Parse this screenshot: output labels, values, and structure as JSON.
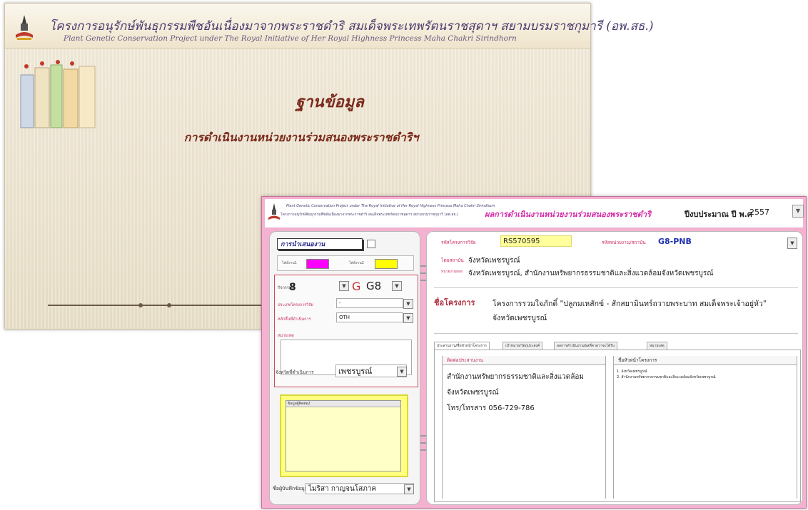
{
  "background_window": {
    "title_th": "โครงการอนุรักษ์พันธุกรรมพืชอันเนื่องมาจากพระราชดำริ สมเด็จพระเทพรัตนราชสุดาฯ สยามบรมราชกุมารี (อพ.สธ.)",
    "title_en": "Plant Genetic Conservation Project under The Royal Initiative of Her Royal Highness Princess Maha Chakri Sirindhorn",
    "main_title": "ฐานข้อมูล",
    "sub_title": "การดำเนินงานหน่วยงานร่วมสนองพระราชดำริฯ"
  },
  "form_window": {
    "header": {
      "project_en": "Plant Genetic Conservation Project under The Royal Initiative of Her Royal Highness Princess Maha Chakri Sirindhorn",
      "project_th": "โครงการอนุรักษ์พันธุกรรมพืชอันเนื่องมาจากพระราชดำริ สมเด็จพระเทพรัตนราชสุดาฯ สยามบรมราชกุมารี (อพ.สธ.)",
      "title": "ผลการดำเนินงานหน่วยงานร่วมสนองพระราชดำริ",
      "year_label": "ปีงบประมาณ ปี พ.ศ",
      "year_value": "2557"
    },
    "left": {
      "tag": "การนำเสนองาน",
      "status1_label": "ไฟล์งาน1",
      "status1_color": "#ff00ff",
      "status2_label": "ไฟล์งาน2",
      "status2_color": "#ffff00",
      "activity_label": "กิจกรรมที่",
      "activity_value": "8",
      "group_prefix": "G",
      "group_value": "G8",
      "research_type_label": "ประเภทโครงการวิจัย",
      "research_type_value": "-",
      "operation_label": "หลักสิ้นที่ดำเนินการ",
      "operation_value": "OTH",
      "note_label": "หมายเหตุ",
      "province_label": "จังหวัดที่ดำเนินการ",
      "province_value": "เพชรบูรณ์",
      "attachments_head": "ข้อมูลผู้ติดต่อ2",
      "recorder_label": "ชื่อผู้บันทึกข้อมูล",
      "recorder_value": "ไมริสา กาญจนโสภาค"
    },
    "right": {
      "research_code_label": "รหัสโครงการวิจัย",
      "research_code_value": "RS570595",
      "unit_code_label": "รหัสหน่วยงาน/สถาบัน",
      "unit_code_value": "G8-PNB",
      "institution_label": "โดยสถาบัน",
      "institution_value": "จังหวัดเพชรบูรณ์",
      "sub_unit_label": "หน่วยงานย่อย",
      "sub_unit_value": "จังหวัดเพชรบูรณ์, สำนักงานทรัพยากรธรรมชาติและสิ่งแวดล้อมจังหวัดเพชรบูรณ์",
      "project_label": "ชื่อโครงการ",
      "project_line1": "โครงการรวมใจภักดิ์ \"ปลูกมเหสักข์ - สักสยามินทร์ถวายพระบาท สมเด็จพระเจ้าอยู่หัว\"",
      "project_line2": "จังหวัดเพชรบูรณ์",
      "tabs": [
        "ประสานงาน/ชื่อหัวหน้าโครงการ",
        "เป้าหมาย/วัตถุประสงค์",
        "ผลการดำเนินงาน/ผลที่คาดว่าจะได้รับ",
        "หมายเหตุ"
      ],
      "contact_head": "ติดต่อประสานงาน",
      "contact_lines": [
        "สำนักงานทรัพยากรธรรมชาติและสิ่งแวดล้อม",
        "จังหวัดเพชรบูรณ์",
        "โทร/โทรสาร 056-729-786"
      ],
      "leaders_head": "ชื่อหัวหน้าโครงการ",
      "leaders": [
        "1. จังหวัดเพชรบูรณ์",
        "2. สำนักงานทรัพยากรธรรมชาติและสิ่งแวดล้อมจังหวัดเพชรบูรณ์"
      ]
    }
  }
}
